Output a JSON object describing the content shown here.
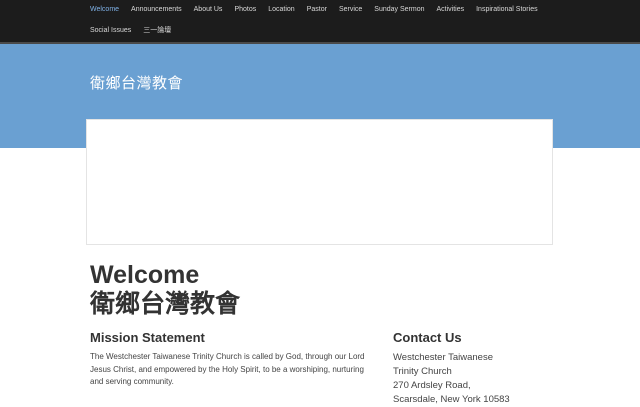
{
  "nav": {
    "row1": [
      "Welcome",
      "Announcements",
      "About Us",
      "Photos",
      "Location",
      "Pastor",
      "Service",
      "Sunday Sermon",
      "Activities",
      "Inspirational Stories"
    ],
    "row2": [
      "Social Issues",
      "三一論壇"
    ],
    "active": "Welcome"
  },
  "site": {
    "title": "衛鄉台灣教會"
  },
  "welcome": {
    "line1": "Welcome",
    "line2": "衛鄉台灣教會"
  },
  "mission": {
    "heading": "Mission Statement",
    "text": "The Westchester Taiwanese Trinity Church is called by God, through our Lord Jesus Christ, and empowered by the Holy Spirit, to be a worshiping, nurturing and serving community."
  },
  "contact": {
    "heading": "Contact Us",
    "lines": [
      "Westchester Taiwanese",
      "Trinity Church",
      "270 Ardsley Road,",
      "Scarsdale, New York 10583"
    ]
  },
  "colors": {
    "nav_bg": "#1c1c1c",
    "nav_active": "#7fb1e6",
    "banner": "#6aa0d2"
  }
}
